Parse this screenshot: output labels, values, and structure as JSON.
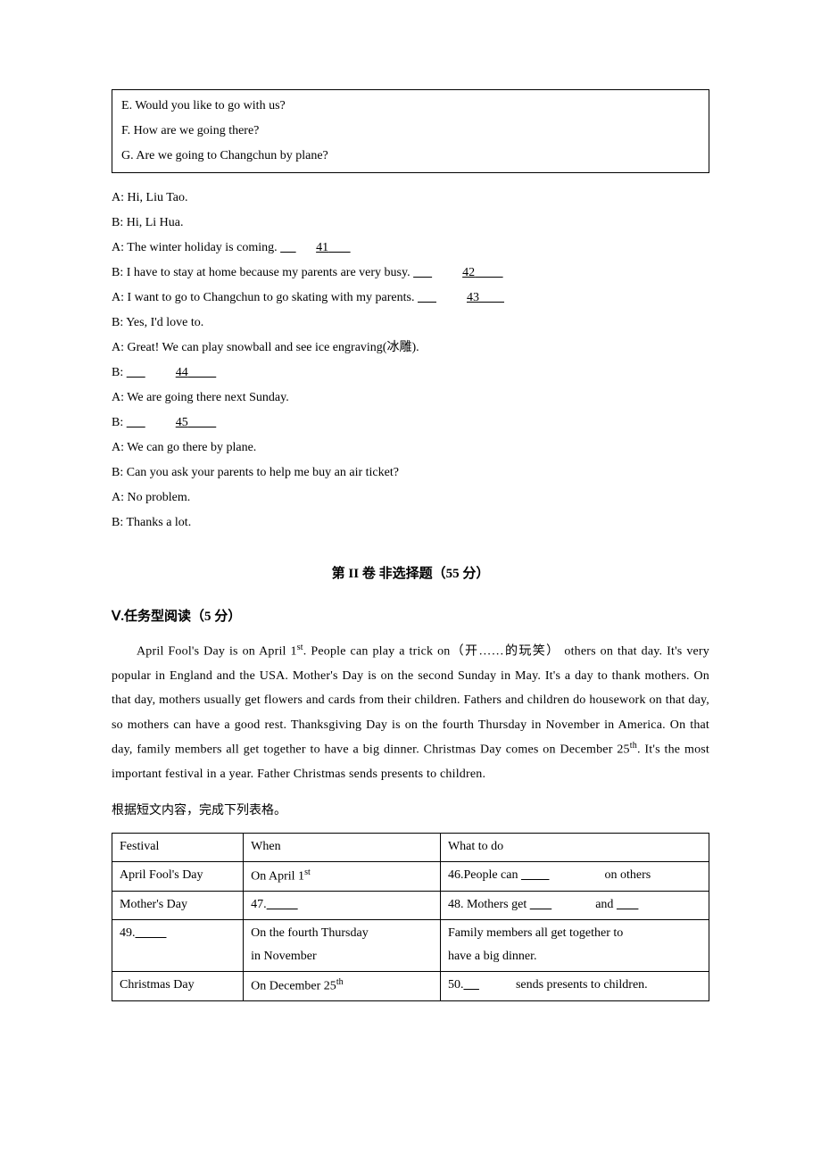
{
  "choices": {
    "items": [
      {
        "letter": "E",
        "text": "Would you like to go with us?"
      },
      {
        "letter": "F",
        "text": "How are we going there?"
      },
      {
        "letter": "G",
        "text": "Are we going to Changchun by plane?"
      }
    ]
  },
  "dialogue": {
    "lines": [
      {
        "speaker": "A",
        "text": "Hi, Liu Tao."
      },
      {
        "speaker": "B",
        "text": "Hi, Li Hua."
      },
      {
        "speaker": "A",
        "text": "The winter holiday is coming.",
        "blank_num": "41"
      },
      {
        "speaker": "B",
        "text": "I have to stay at home because my parents are very busy.",
        "blank_num": "42"
      },
      {
        "speaker": "A",
        "text": "I want to go to Changchun to go skating with my parents.",
        "blank_num": "43"
      },
      {
        "speaker": "B",
        "text": "Yes, I'd love to."
      },
      {
        "speaker": "A",
        "text": "Great! We can play snowball and see ice engraving(冰雕)."
      },
      {
        "speaker": "B",
        "blank_num": "44"
      },
      {
        "speaker": "A",
        "text": "We are going there next Sunday."
      },
      {
        "speaker": "B",
        "blank_num": "45"
      },
      {
        "speaker": "A",
        "text": "We can go there by plane."
      },
      {
        "speaker": "B",
        "text": "Can you ask your parents to help me buy an air ticket?"
      },
      {
        "speaker": "A",
        "text": "No problem."
      },
      {
        "speaker": "B",
        "text": "Thanks a lot."
      }
    ]
  },
  "part2_header": "第 II 卷 非选择题（55 分）",
  "section5_heading": "Ⅴ.任务型阅读（5 分）",
  "passage": {
    "sentences": {
      "s1a": "April Fool's Day is on April 1",
      "s1b": ". People can play a trick on（开……的玩笑）",
      "s2": "others on that day. It's very popular in England and the USA. Mother's Day is on",
      "s3": "the second Sunday in May. It's a day to thank mothers. On that day, mothers usually",
      "s4": "get flowers and cards from their children. Fathers and children do housework on that",
      "s5": "day, so mothers can have a good rest. Thanksgiving Day is on the fourth Thursday",
      "s6": "in November in America. On that day, family members all get together to have a big",
      "s7a": "dinner. Christmas Day comes on December 25",
      "s7b": ". It's the most important festival in",
      "s8": "a year. Father Christmas sends presents to children."
    }
  },
  "table_instruction": "根据短文内容，完成下列表格。",
  "table": {
    "headers": {
      "c1": "Festival",
      "c2": "When",
      "c3": "What to do"
    },
    "rows": [
      {
        "c1": "April Fool's Day",
        "c2a": "On April 1",
        "c2sup": "st",
        "c3_pre": "46.People can ",
        "c3_post": " on others"
      },
      {
        "c1": "Mother's Day",
        "c2_pre": "47.",
        "c3_pre": "48. Mothers get ",
        "c3_mid": " and "
      },
      {
        "c1_pre": "49.",
        "c2_line1": "On the fourth Thursday",
        "c2_line2": "in November",
        "c3_line1": "Family members all get together to",
        "c3_line2": "have a big dinner."
      },
      {
        "c1": "Christmas Day",
        "c2a": "On December 25",
        "c2sup": "th",
        "c3_pre": "50.",
        "c3_post": " sends presents to children."
      }
    ]
  }
}
